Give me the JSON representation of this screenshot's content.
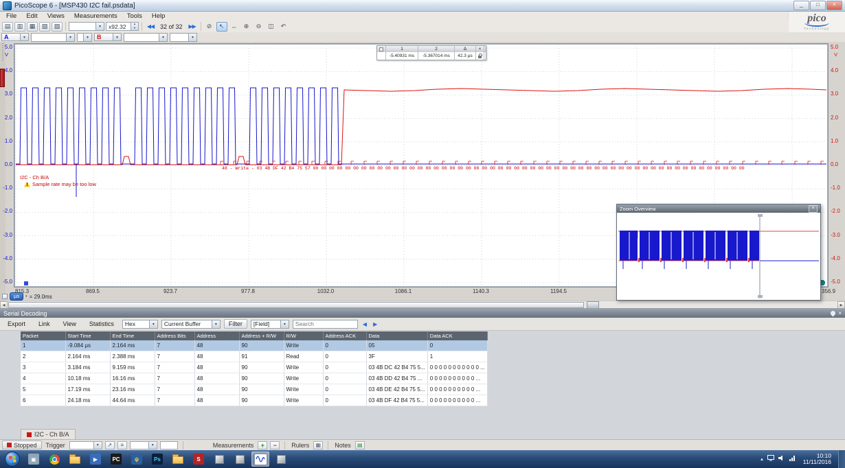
{
  "titlebar": {
    "title": "PicoScope 6 - [MSP430 I2C fail.psdata]",
    "minimize": "_",
    "restore": "□",
    "close": "×"
  },
  "menubar": {
    "items": [
      "File",
      "Edit",
      "Views",
      "Measurements",
      "Tools",
      "Help"
    ]
  },
  "brand": {
    "name": "pico",
    "sub": "Technology"
  },
  "toolbar": {
    "view_icons": [
      {
        "name": "scope-view-icon",
        "glyph": "▤"
      },
      {
        "name": "spectrum-view-icon",
        "glyph": "▥"
      },
      {
        "name": "grid-layout-icon",
        "glyph": "▦"
      },
      {
        "name": "persistence-view-icon",
        "glyph": "▧"
      },
      {
        "name": "notes-view-icon",
        "glyph": "▨"
      }
    ],
    "zoom_value": "x92.32",
    "prev_buffer": "◀◀",
    "buffer_position": "32 of 32",
    "next_buffer": "▶▶",
    "tool_icons": [
      {
        "name": "no-tool-icon",
        "glyph": "⊘"
      },
      {
        "name": "pointer-tool-icon",
        "glyph": "↖"
      },
      {
        "name": "hand-tool-icon",
        "glyph": "⇔"
      },
      {
        "name": "zoom-in-icon",
        "glyph": "⊕"
      },
      {
        "name": "zoom-out-icon",
        "glyph": "⊖"
      },
      {
        "name": "window-zoom-icon",
        "glyph": "◫"
      },
      {
        "name": "undo-zoom-icon",
        "glyph": "↶"
      }
    ]
  },
  "chanbar": {
    "a_label": "A",
    "b_label": "B"
  },
  "scope": {
    "unit": "V",
    "y_ticks": [
      "5.0",
      "4.0",
      "3.0",
      "2.0",
      "1.0",
      "0.0",
      "-1.0",
      "-2.0",
      "-3.0",
      "-4.0",
      "-5.0"
    ],
    "x_ticks": [
      "815.3",
      "869.5",
      "923.7",
      "977.8",
      "1032.0",
      "1086.1",
      "1140.3",
      "1194.5"
    ],
    "x_partial_right": "356.9",
    "x_unit": "µs",
    "time_note": "= 29.0ms",
    "decode_text": "48 - Write - 03 4B DF 42 B4 75 57 00 00 00 00 00 00 00 00 00 00 00 00 00 00 00 00 00 00 00 00 00 00 00 00 00 00 00 00 00 00 00 00 00 00 00 00 00 00 00 00 00 00 00 00 00 00 00 00 00 00 00 00 00 00",
    "channel_label": "I2C - Ch B/A",
    "warning_text": "Sample rate may be too low",
    "ruler": {
      "c1": "1",
      "c2": "2",
      "c3": "Δ",
      "v1": "-5.40931 ms",
      "v2": "-5.367014 ms",
      "v3": "42.3 µs"
    }
  },
  "waveform": {
    "pulse_count": 26,
    "high_v": 3.3,
    "base_v": 0.05,
    "red_high_v": 3.22,
    "gap_after": [
      9,
      18
    ],
    "spike_v": -1.35
  },
  "zoom_overview": {
    "title": "Zoom Overview",
    "close": "×"
  },
  "serial": {
    "title": "Serial Decoding",
    "buttons": [
      "Export",
      "Link",
      "View",
      "Statistics"
    ],
    "format": "Hex",
    "buffer": "Current Buffer",
    "filter": "Filter",
    "field": "[Field]",
    "search_placeholder": "Search",
    "columns": [
      "Packet",
      "Start Time",
      "End Time",
      "Address Bits",
      "Address",
      "Address + R/W",
      "R/W",
      "Address ACK",
      "Data",
      "Data ACK"
    ],
    "rows": [
      [
        "1",
        "-9.084 µs",
        "2.164 ms",
        "7",
        "48",
        "90",
        "Write",
        "0",
        "05",
        "0"
      ],
      [
        "2",
        "2.164 ms",
        "2.388 ms",
        "7",
        "48",
        "91",
        "Read",
        "0",
        "3F",
        "1"
      ],
      [
        "3",
        "3.184 ms",
        "9.159 ms",
        "7",
        "48",
        "90",
        "Write",
        "0",
        "03 4B DC 42 B4 75 5...",
        "0 0 0 0 0 0 0 0 0 0 0 ..."
      ],
      [
        "4",
        "10.18 ms",
        "16.16 ms",
        "7",
        "48",
        "90",
        "Write",
        "0",
        "03 4B DD 42 B4 75 ...",
        "0 0 0 0 0 0 0 0 0 0 ..."
      ],
      [
        "5",
        "17.19 ms",
        "23.16 ms",
        "7",
        "48",
        "90",
        "Write",
        "0",
        "03 4B DE 42 B4 75 5...",
        "0 0 0 0 0 0 0 0 0 0 ..."
      ],
      [
        "6",
        "24.18 ms",
        "44.64 ms",
        "7",
        "48",
        "90",
        "Write",
        "0",
        "03 4B DF 42 B4 75 5...",
        "0 0 0 0 0 0 0 0 0 0 ..."
      ]
    ],
    "tab": "I2C - Ch B/A"
  },
  "bottombar": {
    "stopped": "Stopped",
    "trigger": "Trigger",
    "measurements": "Measurements",
    "rulers": "Rulers",
    "notes": "Notes"
  },
  "taskbar": {
    "time": "10:10",
    "date": "11/11/2016",
    "icons": [
      {
        "name": "taskbar-media-tool-icon",
        "bg": "#8fa6b8",
        "fg": "#fff",
        "glyph": "▣"
      },
      {
        "name": "taskbar-chrome-icon",
        "special": "chrome"
      },
      {
        "name": "taskbar-folder-icon",
        "special": "folder"
      },
      {
        "name": "taskbar-media-player-icon",
        "bg": "#3a6db8",
        "fg": "#fff",
        "glyph": "▶"
      },
      {
        "name": "taskbar-pycharm-icon",
        "bg": "#1a1a1a",
        "fg": "#fff",
        "glyph": "PC"
      },
      {
        "name": "taskbar-network-analyzer-icon",
        "bg": "#2b5f9e",
        "fg": "#ffd24a",
        "glyph": "ψ"
      },
      {
        "name": "taskbar-photoshop-icon",
        "bg": "#0b1f3a",
        "fg": "#4ac3ff",
        "glyph": "Ps"
      },
      {
        "name": "taskbar-explorer-icon",
        "special": "folder"
      },
      {
        "name": "taskbar-eda-icon",
        "bg": "#b32424",
        "fg": "#fff",
        "glyph": "S"
      },
      {
        "name": "taskbar-cad-cube1-icon",
        "special": "cube"
      },
      {
        "name": "taskbar-cad-cube2-icon",
        "special": "cube"
      },
      {
        "name": "taskbar-picoscope-icon",
        "special": "picoscope",
        "active": true
      },
      {
        "name": "taskbar-utility-icon",
        "special": "cube"
      }
    ]
  },
  "ui": {
    "close": "×"
  }
}
